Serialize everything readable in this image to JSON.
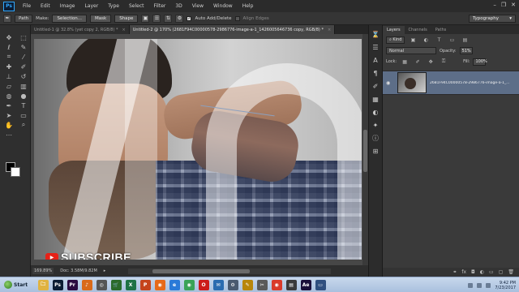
{
  "app": {
    "logo": "Ps",
    "menu": [
      "File",
      "Edit",
      "Image",
      "Layer",
      "Type",
      "Select",
      "Filter",
      "3D",
      "View",
      "Window",
      "Help"
    ],
    "window_controls": [
      "–",
      "❐",
      "✕"
    ]
  },
  "options_bar": {
    "tool_mode": "Path",
    "make_label": "Make:",
    "selection_button": "Selection...",
    "mask_button": "Mask",
    "shape_button": "Shape",
    "auto_add_delete_label": "Auto Add/Delete",
    "auto_add_delete_checked": true,
    "align_edges_label": "Align Edges",
    "workspace": "Typography"
  },
  "document_tabs": [
    {
      "title": "Untitled-1 @ 32.8% (yet copy 2, RGB/8) *",
      "active": false
    },
    {
      "title": "Untitled-2 @ 170% (2681F94C00000578-2986776-image-a-1_1426005646736 copy, RGB/8) *",
      "active": true
    }
  ],
  "canvas": {
    "overlay_text": "SUBSCRIBE",
    "yt_icon": "▶"
  },
  "status_bar": {
    "zoom": "169.89%",
    "doc": "Doc: 3.58M/9.82M"
  },
  "layers_panel": {
    "tabs": [
      "Layers",
      "Channels",
      "Paths"
    ],
    "kind_filter": "Kind",
    "blend_mode": "Normal",
    "opacity_label": "Opacity:",
    "opacity_value": "51%",
    "lock_label": "Lock:",
    "fill_label": "Fill:",
    "fill_value": "100%",
    "layers": [
      {
        "name": "2681F94C00000578-2986776-image-a-1_...",
        "visible": true,
        "selected": true
      }
    ]
  },
  "taskbar": {
    "start_label": "Start",
    "apps": [
      {
        "name": "folder",
        "glyph": "🗀",
        "color": "#e0b341"
      },
      {
        "name": "photoshop",
        "glyph": "Ps",
        "color": "#0b1c33"
      },
      {
        "name": "premiere",
        "glyph": "Pr",
        "color": "#2a0a40"
      },
      {
        "name": "media",
        "glyph": "♪",
        "color": "#d96a1a"
      },
      {
        "name": "headphones",
        "glyph": "◎",
        "color": "#555555"
      },
      {
        "name": "cart",
        "glyph": "🛒",
        "color": "#2a6a2a"
      },
      {
        "name": "excel",
        "glyph": "X",
        "color": "#1f7244"
      },
      {
        "name": "powerpoint",
        "glyph": "P",
        "color": "#c5441c"
      },
      {
        "name": "firefox",
        "glyph": "◉",
        "color": "#e66a1a"
      },
      {
        "name": "ie",
        "glyph": "e",
        "color": "#2a7ad8"
      },
      {
        "name": "chrome",
        "glyph": "◉",
        "color": "#3aa356"
      },
      {
        "name": "opera",
        "glyph": "O",
        "color": "#cc1b1b"
      },
      {
        "name": "mail",
        "glyph": "✉",
        "color": "#2b6cb0"
      },
      {
        "name": "network",
        "glyph": "⚙",
        "color": "#4a5a70"
      },
      {
        "name": "paint",
        "glyph": "✎",
        "color": "#b8860b"
      },
      {
        "name": "tools",
        "glyph": "✂",
        "color": "#5a5a5a"
      },
      {
        "name": "chrome2",
        "glyph": "◉",
        "color": "#d93a2b"
      },
      {
        "name": "editor",
        "glyph": "▤",
        "color": "#3a3a3a"
      },
      {
        "name": "aftereffects",
        "glyph": "Ae",
        "color": "#1a0f3a"
      },
      {
        "name": "monitor",
        "glyph": "▭",
        "color": "#2f4f7f"
      }
    ],
    "time": "9:42 PM",
    "date": "7/23/2017"
  }
}
